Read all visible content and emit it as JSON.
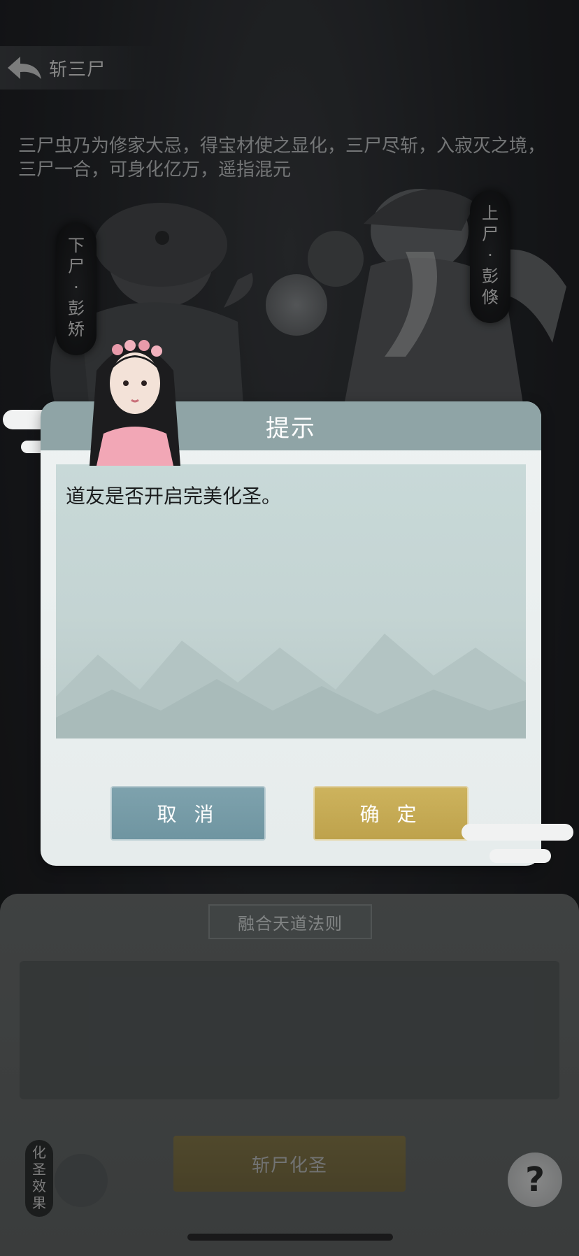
{
  "header": {
    "title": "斩三尸"
  },
  "intro_text": "三尸虫乃为修家大忌，得宝材使之显化，三尸尽斩，入寂灭之境，三尸一合，可身化亿万，遥指混元",
  "scene": {
    "left_tag": "下尸·彭矫",
    "right_tag": "上尸·彭倏"
  },
  "bottom": {
    "fuse_title": "融合天道法则",
    "slash_button": "斩尸化圣",
    "effect_label": "化圣效果",
    "help_label": "?"
  },
  "dialog": {
    "title": "提示",
    "message": "道友是否开启完美化圣。",
    "cancel_label": "取 消",
    "confirm_label": "确 定"
  },
  "icons": {
    "back": "back-arrow-icon",
    "help": "question-mark-icon"
  },
  "colors": {
    "dialog_header": "#8fa4a6",
    "cancel_button": "#7ea2ad",
    "confirm_button": "#cdb35d",
    "slash_button": "#8a7d4c"
  }
}
